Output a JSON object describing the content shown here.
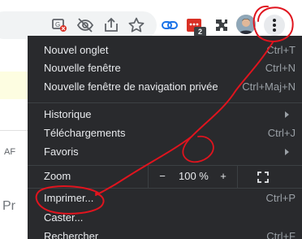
{
  "toolbar": {
    "icons": [
      "translate-off-icon",
      "eye-off-icon",
      "share-icon",
      "star-icon",
      "link-extension-icon",
      "calendar-extension-icon",
      "puzzle-icon",
      "avatar",
      "kebab-menu-icon"
    ],
    "extension_badge": "2"
  },
  "page": {
    "fragment_1": "AF",
    "fragment_2": "Pr"
  },
  "menu": {
    "items": [
      {
        "label": "Nouvel onglet",
        "shortcut": "Ctrl+T"
      },
      {
        "label": "Nouvelle fenêtre",
        "shortcut": "Ctrl+N"
      },
      {
        "label": "Nouvelle fenêtre de navigation privée",
        "shortcut": "Ctrl+Maj+N"
      },
      {
        "label": "Historique",
        "shortcut": ""
      },
      {
        "label": "Téléchargements",
        "shortcut": "Ctrl+J"
      },
      {
        "label": "Favoris",
        "shortcut": ""
      },
      {
        "label": "Imprimer...",
        "shortcut": "Ctrl+P"
      },
      {
        "label": "Caster...",
        "shortcut": ""
      },
      {
        "label": "Rechercher",
        "shortcut": "Ctrl+F"
      }
    ],
    "zoom": {
      "label": "Zoom",
      "minus": "−",
      "value": "100 %",
      "plus": "+"
    }
  },
  "colors": {
    "menu_bg": "#292a2d",
    "menu_text": "#e8eaed",
    "shortcut_text": "#9aa0a6",
    "annotation_red": "#e0141e"
  }
}
